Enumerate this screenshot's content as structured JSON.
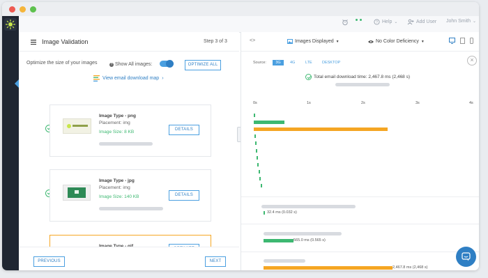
{
  "topbar": {
    "help_label": "Help",
    "add_user_label": "Add User",
    "user_name": "John Smith"
  },
  "left": {
    "title": "Image Validation",
    "step": "Step 3 of 3",
    "optimize_prompt": "Optimize the size of your images",
    "show_all_label": "Show All images:",
    "optimize_all_label": "OPTIMIZE ALL",
    "email_map_link": "View email download map",
    "cards": [
      {
        "type": "Image Type - png",
        "placement": "Placement: img",
        "size": "Image Size: 8 KB",
        "button": "DETAILS"
      },
      {
        "type": "Image Type - jpg",
        "placement": "Placement: img",
        "size": "Image Size: 140 KB",
        "button": "DETAILS"
      },
      {
        "type": "Image Type - gif",
        "button": "OPTIMIZE"
      }
    ],
    "previous_label": "PREVIOUS",
    "next_label": "NEXT"
  },
  "right": {
    "images_displayed_label": "Images Displayed",
    "color_def_label": "No Color Deficiency",
    "source_label": "Source:",
    "sources": [
      "3G",
      "4G",
      "LTE",
      "DESKTOP"
    ],
    "active_source": "3G",
    "total_time": "Total email download time: 2,467.8 ms (2,468 s)",
    "axis_ticks": [
      "0s",
      "1s",
      "2s",
      "3s",
      "4s"
    ],
    "detail_labels": [
      "32.4 ms (0.032 s)",
      "565.0 ms (0.565 s)",
      "2,467.8 ms (2,468 s)"
    ]
  },
  "colors": {
    "accent": "#4a9fe0",
    "green": "#3db871",
    "orange": "#f5a623",
    "sidebar": "#1f2632"
  }
}
